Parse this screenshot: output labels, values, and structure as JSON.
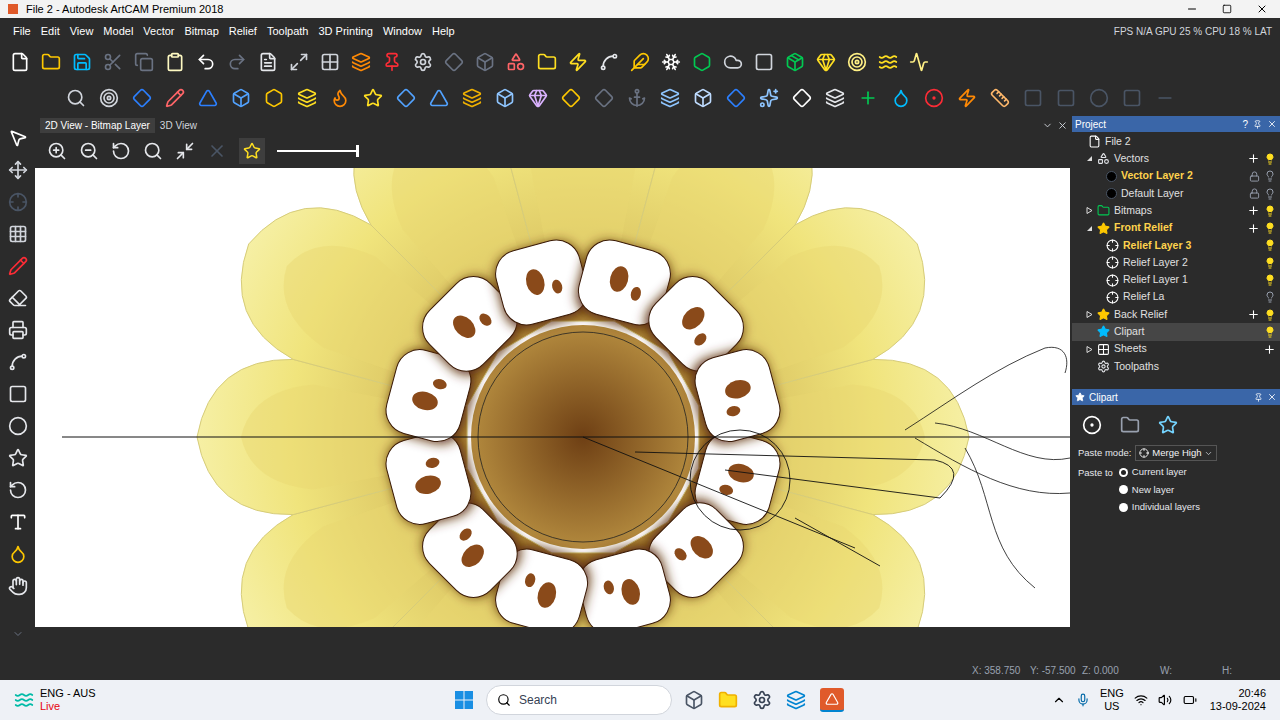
{
  "window": {
    "title": "File 2 - Autodesk ArtCAM Premium 2018"
  },
  "menu": [
    "File",
    "Edit",
    "View",
    "Model",
    "Vector",
    "Bitmap",
    "Relief",
    "Toolpath",
    "3D Printing",
    "Window",
    "Help"
  ],
  "performance": "FPS N/A GPU 25 % CPU 18 % LAT",
  "view_tabs": [
    {
      "label": "2D View - Bitmap Layer",
      "selected": true
    },
    {
      "label": "3D View",
      "selected": false
    }
  ],
  "zoom_slider": {
    "level": 1
  },
  "project_panel": {
    "title": "Project",
    "help": "?",
    "tree": [
      {
        "label": "File 2",
        "level": 0,
        "kind": "file",
        "selected": false,
        "active": false
      },
      {
        "label": "Vectors",
        "level": 1,
        "kind": "vectors",
        "expanded": true,
        "add": true,
        "visible": true,
        "selected": false,
        "active": false
      },
      {
        "label": "Vector Layer 2",
        "level": 2,
        "kind": "vector-layer",
        "locked": true,
        "visible": false,
        "selected": false,
        "active": true
      },
      {
        "label": "Default Layer",
        "level": 2,
        "kind": "vector-layer",
        "locked": true,
        "visible": false,
        "selected": false,
        "active": false
      },
      {
        "label": "Bitmaps",
        "level": 1,
        "kind": "bitmaps",
        "expanded": false,
        "add": true,
        "visible": true,
        "selected": false,
        "active": false
      },
      {
        "label": "Front Relief",
        "level": 1,
        "kind": "relief",
        "expanded": true,
        "add": true,
        "visible": true,
        "selected": false,
        "active": true
      },
      {
        "label": "Relief Layer 3",
        "level": 2,
        "kind": "relief-layer",
        "visible": true,
        "selected": false,
        "active": true
      },
      {
        "label": "Relief Layer 2",
        "level": 2,
        "kind": "relief-layer",
        "visible": true,
        "selected": false,
        "active": false
      },
      {
        "label": "Relief Layer 1",
        "level": 2,
        "kind": "relief-layer",
        "visible": true,
        "selected": false,
        "active": false
      },
      {
        "label": "Relief La",
        "level": 2,
        "kind": "relief-layer",
        "visible": false,
        "selected": false,
        "active": false
      },
      {
        "label": "Back Relief",
        "level": 1,
        "kind": "relief",
        "expanded": false,
        "add": true,
        "visible": true,
        "selected": false,
        "active": false
      },
      {
        "label": "Clipart",
        "level": 1,
        "kind": "clipart",
        "visible": true,
        "selected": true,
        "active": false
      },
      {
        "label": "Sheets",
        "level": 1,
        "kind": "sheets",
        "expanded": false,
        "add": true,
        "selected": false,
        "active": false
      },
      {
        "label": "Toolpaths",
        "level": 1,
        "kind": "toolpaths",
        "selected": false,
        "active": false
      }
    ]
  },
  "clipart_panel": {
    "title": "Clipart",
    "paste_mode_label": "Paste mode:",
    "paste_mode": "Merge High",
    "paste_to_label": "Paste to",
    "paste_to": [
      {
        "label": "Current layer",
        "selected": true
      },
      {
        "label": "New layer",
        "selected": false
      },
      {
        "label": "Individual layers",
        "selected": false
      }
    ]
  },
  "status_bar": {
    "x": "X: 358.750",
    "y": "Y: -57.500",
    "z": "Z: 0.000",
    "w": "W:",
    "h": "H:"
  },
  "taskbar": {
    "weather_line1": "ENG - AUS",
    "weather_line2": "Live",
    "search_placeholder": "Search",
    "language": "ENG",
    "region": "US",
    "time": "20:46",
    "date": "13-09-2024"
  }
}
